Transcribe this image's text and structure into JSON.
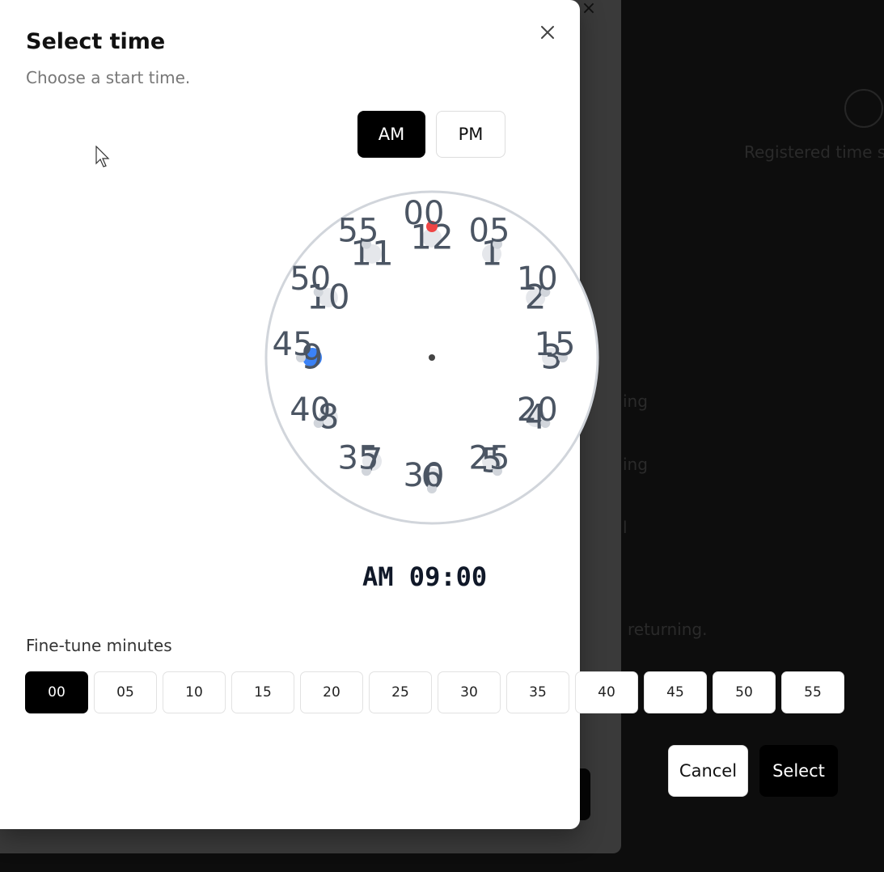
{
  "background": {
    "close_glyph": "×",
    "registered_text": "Registered time slots",
    "row_texts": [
      "ing",
      "ing",
      "l",
      "returning."
    ]
  },
  "dialog": {
    "title": "Select time",
    "subtitle": "Choose a start time.",
    "close_label": "Close",
    "period": {
      "am_label": "AM",
      "pm_label": "PM",
      "selected": "AM"
    },
    "readout": "AM 09:00",
    "fine_label": "Fine-tune minutes",
    "minutes": [
      "00",
      "05",
      "10",
      "15",
      "20",
      "25",
      "30",
      "35",
      "40",
      "45",
      "50",
      "55"
    ],
    "selected_minute": "00",
    "cancel_label": "Cancel",
    "select_label": "Select"
  },
  "clock": {
    "hours": [
      "12",
      "1",
      "2",
      "3",
      "4",
      "5",
      "6",
      "7",
      "8",
      "9",
      "10",
      "11"
    ],
    "minute_labels": [
      "00",
      "05",
      "10",
      "15",
      "20",
      "25",
      "30",
      "35",
      "40",
      "45",
      "50",
      "55"
    ],
    "selected_hour": "9",
    "selected_minute": "00",
    "colors": {
      "hour_hand": "#3b82f6",
      "minute_hand": "#ef4444",
      "face_border": "#d1d5db",
      "label": "#4b5563",
      "dot": "#e5e7eb"
    }
  }
}
